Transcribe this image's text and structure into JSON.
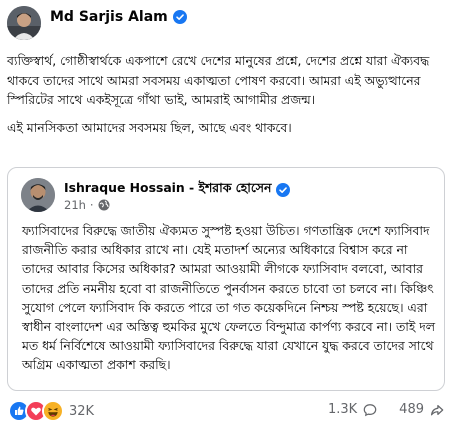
{
  "post": {
    "author": "Md Sarjis Alam",
    "paragraphs": [
      "ব্যক্তিস্বার্থ, গোষ্ঠীস্বার্থকে একপাশে রেখে দেশের মানুষের প্রশ্নে, দেশের প্রশ্নে যারা ঐক্যবদ্ধ থাকবে তাদের সাথে আমরা সবসময় একাত্মতা পোষণ করবো। আমরা এই অভ্যুত্থানের স্পিরিটের সাথে একইসূত্রে গাঁথা ভাই, আমরাই আগামীর প্রজন্ম।",
      "এই মানসিকতা আমাদের সবসময় ছিল, আছে এবং থাকবে।"
    ]
  },
  "shared_post": {
    "author": "Ishraque Hossain - ইশরাক হোসেন",
    "time": "21h",
    "separator": "·",
    "text": "ফ্যাসিবাদের বিরুদ্ধে জাতীয় ঐক্যমত সুস্পষ্ট হওয়া উচিত। গণতান্ত্রিক দেশে ফ্যাসিবাদ রাজনীতি করার অধিকার রাখে না। যেই মতাদর্শ অন্যের অধিকারে বিশ্বাস করে না তাদের আবার কিসের অধিকার? আমরা আওয়ামী লীগকে ফ্যাসিবাদ বলবো, আবার তাদের প্রতি নমনীয় হবো বা রাজনীতিতে পুনর্বাসন করতে চাবো তা চলবে না। কিঞ্চিৎ সুযোগ পেলে ফ্যাসিবাদ কি করতে পারে তা গত কয়েকদিনে নিশ্চয় স্পষ্ট হয়েছে। এরা স্বাধীন বাংলাদেশ এর অস্তিত্ব হুমকির মুখে ফেলতে বিন্দুমাত্র কার্পণ্য করবে না। তাই দল মত ধর্ম নির্বিশেষে আওয়ামী ফ্যাসিবাদের বিরুদ্ধে যারা যেখানে যুদ্ধ করবে তাদের সাথে অগ্রিম একাত্মতা প্রকাশ করছি।"
  },
  "footer": {
    "reaction_count": "32K",
    "comment_count": "1.3K",
    "share_count": "489"
  },
  "colors": {
    "verified": "#1877f2",
    "like": "#1877f2",
    "love": "#f33e58",
    "haha": "#f7b125",
    "secondary_text": "#65676b",
    "border": "#ced0d4"
  },
  "icons": [
    "verified-badge-icon",
    "globe-icon",
    "like-reaction-icon",
    "love-reaction-icon",
    "haha-reaction-icon",
    "comment-icon",
    "share-icon"
  ]
}
